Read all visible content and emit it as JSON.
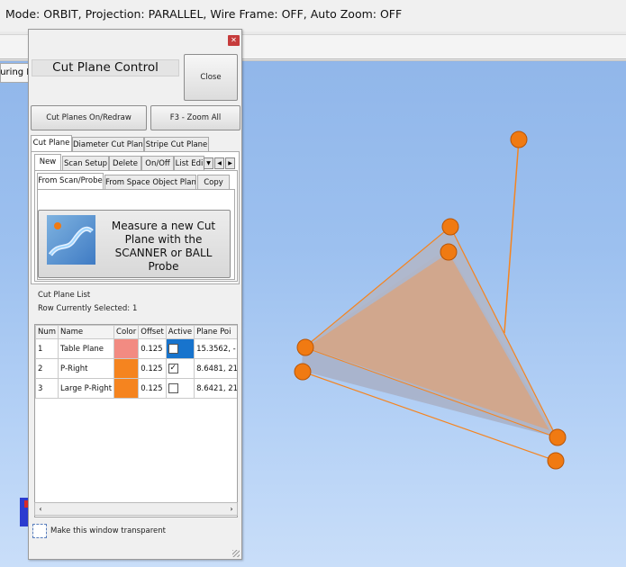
{
  "status_bar": {
    "text": "Mode: ORBIT, Projection: PARALLEL, Wire Frame: OFF, Auto Zoom: OFF"
  },
  "background_tab": {
    "label": "suring I"
  },
  "panel": {
    "title": "Cut Plane Control",
    "close_label": "Close",
    "cut_planes_btn": "Cut Planes On/Redraw",
    "zoom_btn": "F3 - Zoom All",
    "main_tabs": [
      "Cut Plane",
      "Diameter Cut Plane",
      "Stripe Cut Plane"
    ],
    "sub_tabs": [
      "New",
      "Scan Setup",
      "Delete",
      "On/Off",
      "List Edi"
    ],
    "source_tabs": [
      "From Scan/Probe",
      "From Space Object Plane",
      "Copy"
    ],
    "measure_text": "Measure a new Cut Plane with the SCANNER or BALL Probe",
    "list_label": "Cut Plane List",
    "row_selected_label": "Row Currently Selected:",
    "row_selected_value": "1",
    "columns": [
      "Num",
      "Name",
      "Color",
      "Offset",
      "Active",
      "Plane Poi"
    ],
    "rows": [
      {
        "num": "1",
        "name": "Table Plane",
        "color": "#f28b82",
        "offset": "0.125",
        "active": false,
        "plane": "15.3562, -"
      },
      {
        "num": "2",
        "name": "P-Right",
        "color": "#f5841f",
        "offset": "0.125",
        "active": true,
        "plane": "8.6481, 21"
      },
      {
        "num": "3",
        "name": "Large P-Right",
        "color": "#f5841f",
        "offset": "0.125",
        "active": false,
        "plane": "8.6421, 21"
      }
    ],
    "transparent_label": "Make this window transparent"
  },
  "colors": {
    "accent": "#f5841f",
    "selection": "#1874cd",
    "close_red": "#c63b3b"
  }
}
